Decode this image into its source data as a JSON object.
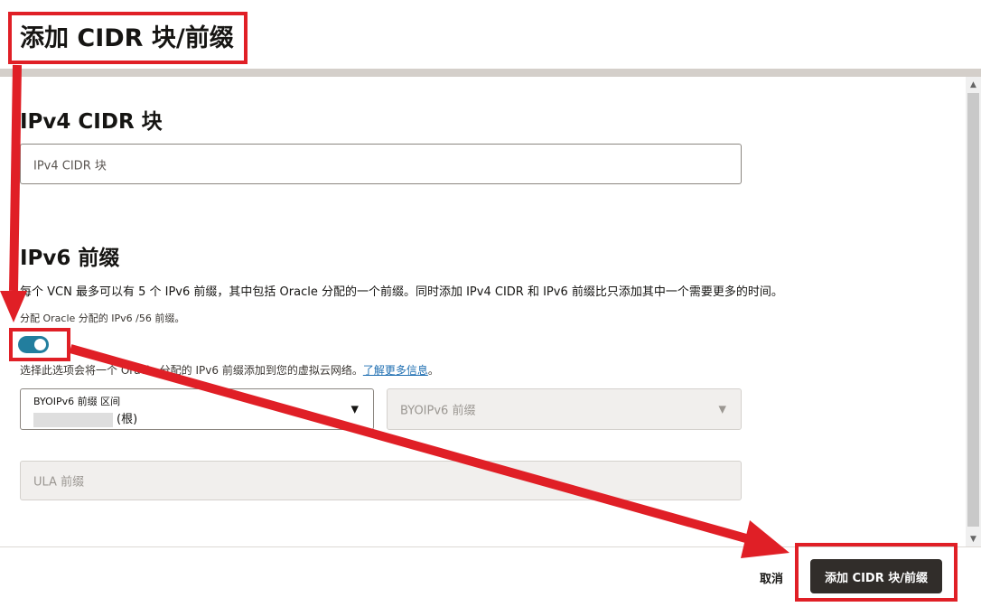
{
  "dialog": {
    "title": "添加 CIDR 块/前缀"
  },
  "ipv4": {
    "heading": "IPv4 CIDR 块",
    "input_placeholder": "IPv4 CIDR 块"
  },
  "ipv6": {
    "heading": "IPv6 前缀",
    "description": "每个 VCN 最多可以有 5 个 IPv6 前缀，其中包括 Oracle 分配的一个前缀。同时添加 IPv4 CIDR 和 IPv6 前缀比只添加其中一个需要更多的时间。",
    "toggle_label": "分配 Oracle 分配的 IPv6 /56 前缀。",
    "toggle_on": true,
    "help_text": "选择此选项会将一个 Oracle 分配的 IPv6 前缀添加到您的虚拟云网络。",
    "help_link": "了解更多信息",
    "help_suffix": "。",
    "byoip_range": {
      "label": "BYOIPv6 前缀 区间",
      "value_suffix": "(根)"
    },
    "byoip_prefix": {
      "placeholder": "BYOIPv6 前缀"
    },
    "ula": {
      "placeholder": "ULA 前缀"
    }
  },
  "footer": {
    "cancel_label": "取消",
    "submit_label": "添加 CIDR 块/前缀"
  },
  "icons": {
    "caret": "caret-down-icon",
    "scroll_up": "scroll-up-icon",
    "scroll_down": "scroll-down-icon"
  },
  "colors": {
    "annotation_red": "#e01f26",
    "toggle_on": "#227e9e",
    "primary_button": "#312d2a",
    "link": "#1f6fb2"
  }
}
